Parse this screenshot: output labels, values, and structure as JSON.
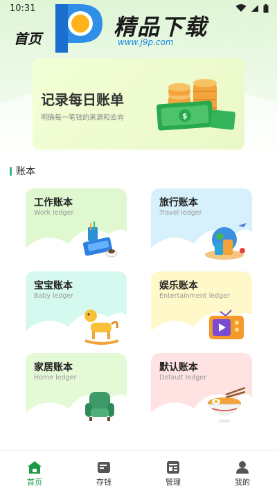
{
  "status_bar": {
    "time": "10:31",
    "icons": [
      "wifi-icon",
      "signal-icon",
      "battery-icon"
    ]
  },
  "header": {
    "title": "首页"
  },
  "watermark": {
    "brand": "精品下载",
    "url": "www.j9p.com"
  },
  "banner": {
    "title": "记录每日账单",
    "subtitle": "明确每一笔钱的来源和去向"
  },
  "section": {
    "title": "账本"
  },
  "ledgers": [
    {
      "name": "工作账本",
      "subtitle": "Work ledger",
      "icon": "desk-books-icon",
      "color": "#dff8cf"
    },
    {
      "name": "旅行账本",
      "subtitle": "Travel ledger",
      "icon": "globe-luggage-icon",
      "color": "#d6f1fb"
    },
    {
      "name": "宝宝账本",
      "subtitle": "Baby ledger",
      "icon": "rocking-horse-icon",
      "color": "#d5f9ef"
    },
    {
      "name": "娱乐账本",
      "subtitle": "Entertainment ledger",
      "icon": "tv-play-icon",
      "color": "#fff8c8"
    },
    {
      "name": "家居账本",
      "subtitle": "Home ledger",
      "icon": "armchair-icon",
      "color": "#e4f9d6"
    },
    {
      "name": "默认账本",
      "subtitle": "Default ledger",
      "icon": "noodle-bowl-icon",
      "color": "#ffe3e3"
    }
  ],
  "bottom_nav": {
    "items": [
      {
        "label": "首页",
        "icon": "home-icon",
        "active": true
      },
      {
        "label": "存钱",
        "icon": "wallet-icon",
        "active": false
      },
      {
        "label": "管理",
        "icon": "list-icon",
        "active": false
      },
      {
        "label": "我的",
        "icon": "user-icon",
        "active": false
      }
    ],
    "active_color": "#1d9a45"
  }
}
